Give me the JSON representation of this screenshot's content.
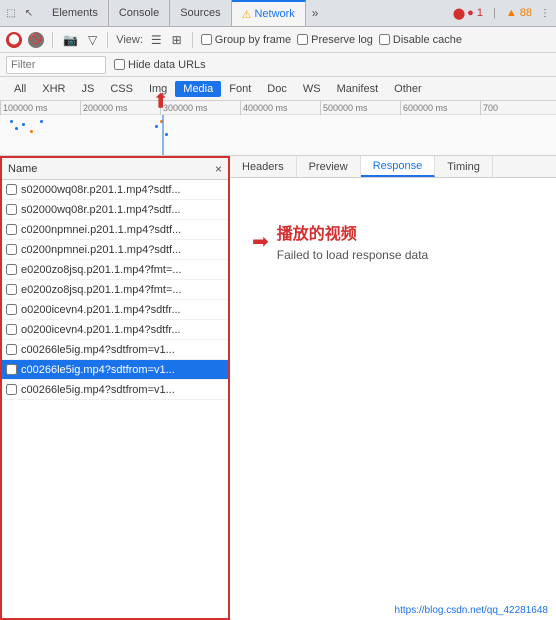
{
  "topbar": {
    "tabs": [
      {
        "label": "Elements",
        "active": false
      },
      {
        "label": "Console",
        "active": false
      },
      {
        "label": "Sources",
        "active": false
      },
      {
        "label": "Network",
        "active": true,
        "warning": true
      },
      {
        "label": "»",
        "more": true
      }
    ],
    "error_badge": "● 1",
    "warning_badge": "▲ 88",
    "kebab": "⋮"
  },
  "toolbar": {
    "record_title": "Record network log",
    "clear_title": "Clear",
    "view_label": "View:",
    "group_by_frame": "Group by frame",
    "preserve_log": "Preserve log",
    "disable_cache": "Disable cache"
  },
  "filterbar": {
    "placeholder": "Filter",
    "hide_data_urls": "Hide data URLs"
  },
  "typetabs": [
    {
      "label": "All",
      "active": false
    },
    {
      "label": "XHR",
      "active": false
    },
    {
      "label": "JS",
      "active": false
    },
    {
      "label": "CSS",
      "active": false
    },
    {
      "label": "Img",
      "active": false
    },
    {
      "label": "Media",
      "active": true
    },
    {
      "label": "Font",
      "active": false
    },
    {
      "label": "Doc",
      "active": false
    },
    {
      "label": "WS",
      "active": false
    },
    {
      "label": "Manifest",
      "active": false
    },
    {
      "label": "Other",
      "active": false
    }
  ],
  "timeline": {
    "marks": [
      "100000 ms",
      "200000 ms",
      "300000 ms",
      "400000 ms",
      "500000 ms",
      "600000 ms",
      "700"
    ]
  },
  "list": {
    "header": "Name",
    "close_label": "×",
    "items": [
      {
        "name": "s02000wq08r.p201.1.mp4?sdtf...",
        "selected": false
      },
      {
        "name": "s02000wq08r.p201.1.mp4?sdtf...",
        "selected": false
      },
      {
        "name": "c0200npmnei.p201.1.mp4?sdtf...",
        "selected": false
      },
      {
        "name": "c0200npmnei.p201.1.mp4?sdtf...",
        "selected": false
      },
      {
        "name": "e0200zo8jsq.p201.1.mp4?fmt=...",
        "selected": false
      },
      {
        "name": "e0200zo8jsq.p201.1.mp4?fmt=...",
        "selected": false
      },
      {
        "name": "o0200icevn4.p201.1.mp4?sdtfr...",
        "selected": false
      },
      {
        "name": "o0200icevn4.p201.1.mp4?sdtfr...",
        "selected": false
      },
      {
        "name": "c00266le5ig.mp4?sdtfrom=v1...",
        "selected": false
      },
      {
        "name": "c00266le5ig.mp4?sdtfrom=v1...",
        "selected": true
      },
      {
        "name": "c00266le5ig.mp4?sdtfrom=v1...",
        "selected": false
      }
    ]
  },
  "rightpanel": {
    "tabs": [
      "Headers",
      "Preview",
      "Response",
      "Timing"
    ],
    "active_tab": "Response",
    "annotation_cn": "播放的视频",
    "annotation_en": "Failed to load response data"
  },
  "watermark": "https://blog.csdn.net/qq_42281648"
}
